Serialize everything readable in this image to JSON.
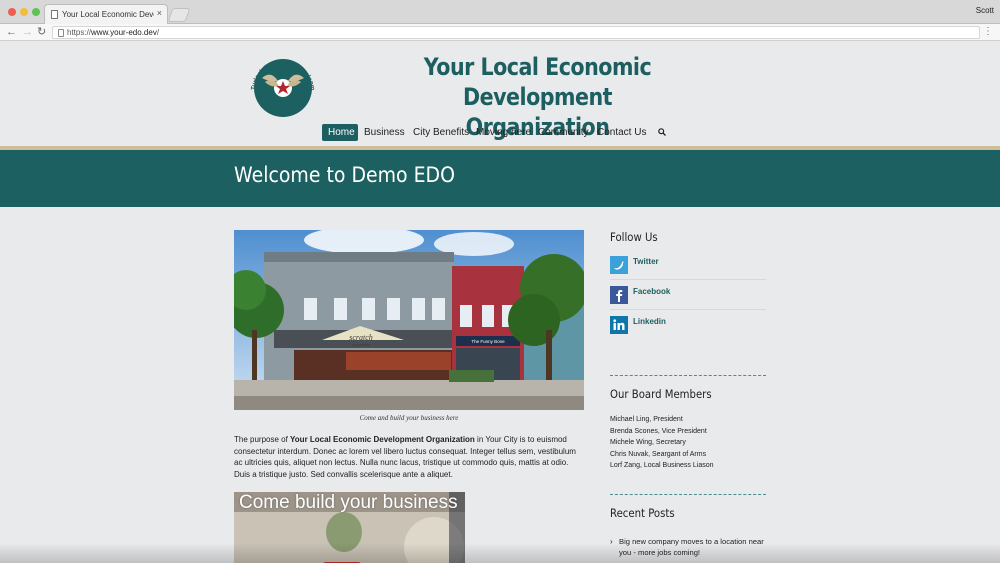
{
  "browser": {
    "tab_title": "Your Local Economic Development Organization",
    "tab_close": "×",
    "profile_name": "Scott",
    "url_scheme": "https://",
    "url_domain": "www.your-edo.dev",
    "url_path": "/",
    "menu_glyph": "⋮",
    "icons": [
      "back-arrow-icon",
      "forward-arrow-icon",
      "reload-icon",
      "lock-icon",
      "page-icon",
      "kebab-menu-icon"
    ]
  },
  "logo": {
    "ring_text": "Turlock Economic Development • Prosperity",
    "colors": {
      "ring": "#1d6061",
      "center": "#ffffff",
      "star": "#b3262d"
    }
  },
  "site": {
    "title_line1": "Your Local Economic",
    "title_line2": "Development Organization",
    "brand_color": "#1d5f60",
    "accent_color": "#cdbf9b"
  },
  "nav": {
    "items": [
      {
        "label": "Home",
        "active": true
      },
      {
        "label": "Business",
        "active": false
      },
      {
        "label": "City Benefits",
        "active": false
      },
      {
        "label": "Moving here",
        "active": false
      },
      {
        "label": "Community",
        "active": false
      },
      {
        "label": "Contact Us",
        "active": false
      }
    ],
    "search_icon": "search-icon"
  },
  "page": {
    "title": "Welcome to Demo EDO"
  },
  "main": {
    "photo_signs": {
      "shop1": "scratch",
      "shop1_sub": "cupcakery",
      "shop2": "The Funny Bone"
    },
    "photo_caption": "Come and build your business here",
    "intro": {
      "before": "The purpose of ",
      "org": "Your Local Economic Development Organization",
      "after": " in Your City is to euismod consectetur interdum. Donec ac lorem vel libero luctus consequat. Integer tellus sem, vestibulum ac ultricies quis, aliquet non lectus. Nulla nunc lacus, tristique ut commodo quis, mattis at odio. Duis a tristique justo. Sed convallis scelerisque ante a aliquet."
    },
    "video_title": "Come build your business"
  },
  "sidebar": {
    "follow_heading": "Follow Us",
    "social": [
      {
        "label": "Twitter",
        "icon": "twitter-icon",
        "color": "#3aa1d9"
      },
      {
        "label": "Facebook",
        "icon": "facebook-icon",
        "color": "#3b5998"
      },
      {
        "label": "Linkedin",
        "icon": "linkedin-icon",
        "color": "#0e76a8"
      }
    ],
    "board_heading": "Our Board Members",
    "board_members": [
      "Michael Ling, President",
      "Brenda Scones, Vice President",
      "Michele Wing, Secretary",
      "Chris Nuvak, Seargant of Arms",
      "Lorf Zang, Local Business Liason"
    ],
    "posts_heading": "Recent Posts",
    "posts": [
      "Big new company moves to a location near you - more jobs coming!"
    ]
  }
}
